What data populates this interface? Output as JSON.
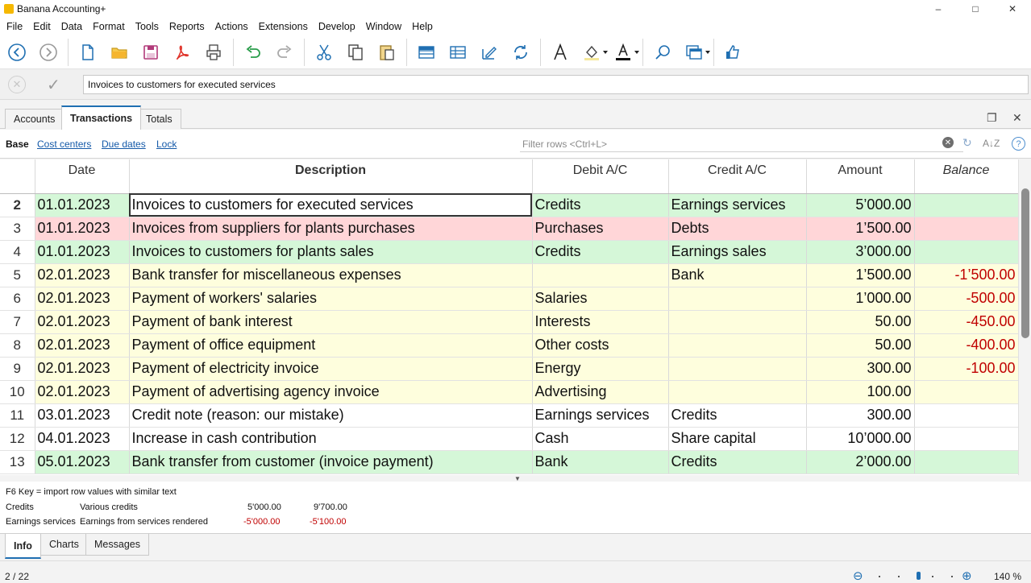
{
  "window": {
    "title": "Banana Accounting+",
    "min": "–",
    "max": "□",
    "close": "✕"
  },
  "menu": [
    "File",
    "Edit",
    "Data",
    "Format",
    "Tools",
    "Reports",
    "Actions",
    "Extensions",
    "Develop",
    "Window",
    "Help"
  ],
  "editbar": {
    "value": "Invoices to customers for executed services"
  },
  "tabs": [
    "Accounts",
    "Transactions",
    "Totals"
  ],
  "views": {
    "base": "Base",
    "links": [
      "Cost centers",
      "Due dates",
      "Lock"
    ]
  },
  "filter": {
    "placeholder": "Filter rows <Ctrl+L>"
  },
  "columns": [
    "Date",
    "Description",
    "Debit A/C",
    "Credit A/C",
    "Amount",
    "Balance"
  ],
  "rows": [
    {
      "n": "2",
      "date": "01.01.2023",
      "desc": "Invoices to customers for executed services",
      "debit": "Credits",
      "credit": "Earnings services",
      "amount": "5’000.00",
      "balance": "",
      "color": "green"
    },
    {
      "n": "3",
      "date": "01.01.2023",
      "desc": "Invoices from suppliers for plants purchases",
      "debit": "Purchases",
      "credit": "Debts",
      "amount": "1’500.00",
      "balance": "",
      "color": "red"
    },
    {
      "n": "4",
      "date": "01.01.2023",
      "desc": "Invoices to customers for plants sales",
      "debit": "Credits",
      "credit": "Earnings sales",
      "amount": "3’000.00",
      "balance": "",
      "color": "green"
    },
    {
      "n": "5",
      "date": "02.01.2023",
      "desc": "Bank transfer for miscellaneous expenses",
      "debit": "",
      "credit": "Bank",
      "amount": "1’500.00",
      "balance": "-1’500.00",
      "color": "yellow"
    },
    {
      "n": "6",
      "date": "02.01.2023",
      "desc": "Payment of workers' salaries",
      "debit": "Salaries",
      "credit": "",
      "amount": "1’000.00",
      "balance": "-500.00",
      "color": "yellow"
    },
    {
      "n": "7",
      "date": "02.01.2023",
      "desc": "Payment of bank interest",
      "debit": "Interests",
      "credit": "",
      "amount": "50.00",
      "balance": "-450.00",
      "color": "yellow"
    },
    {
      "n": "8",
      "date": "02.01.2023",
      "desc": "Payment of office equipment",
      "debit": "Other costs",
      "credit": "",
      "amount": "50.00",
      "balance": "-400.00",
      "color": "yellow"
    },
    {
      "n": "9",
      "date": "02.01.2023",
      "desc": "Payment of electricity invoice",
      "debit": "Energy",
      "credit": "",
      "amount": "300.00",
      "balance": "-100.00",
      "color": "yellow"
    },
    {
      "n": "10",
      "date": "02.01.2023",
      "desc": "Payment of advertising agency invoice",
      "debit": "Advertising",
      "credit": "",
      "amount": "100.00",
      "balance": "",
      "color": "yellow"
    },
    {
      "n": "11",
      "date": "03.01.2023",
      "desc": "Credit note (reason: our mistake)",
      "debit": "Earnings services",
      "credit": "Credits",
      "amount": "300.00",
      "balance": "",
      "color": "white"
    },
    {
      "n": "12",
      "date": "04.01.2023",
      "desc": "Increase in cash contribution",
      "debit": "Cash",
      "credit": "Share capital",
      "amount": "10’000.00",
      "balance": "",
      "color": "white"
    },
    {
      "n": "13",
      "date": "05.01.2023",
      "desc": "Bank transfer from customer (invoice payment)",
      "debit": "Bank",
      "credit": "Credits",
      "amount": "2’000.00",
      "balance": "",
      "color": "green"
    }
  ],
  "info": {
    "hint": "F6 Key = import row values with similar text",
    "line1": {
      "account": "Credits",
      "desc": "Various credits",
      "v1": "5'000.00",
      "v2": "9'700.00"
    },
    "line2": {
      "account": "Earnings services",
      "desc": "Earnings from services rendered",
      "v1": "-5'000.00",
      "v2": "-5'100.00"
    }
  },
  "bottom_tabs": [
    "Info",
    "Charts",
    "Messages"
  ],
  "status": {
    "position": "2 / 22",
    "zoom": "140 %"
  },
  "colors": {
    "accent": "#1f6fb2",
    "green_row": "#d5f7d8",
    "red_row": "#ffd6d8",
    "yellow_row": "#fefedd",
    "negative": "#c00000"
  }
}
